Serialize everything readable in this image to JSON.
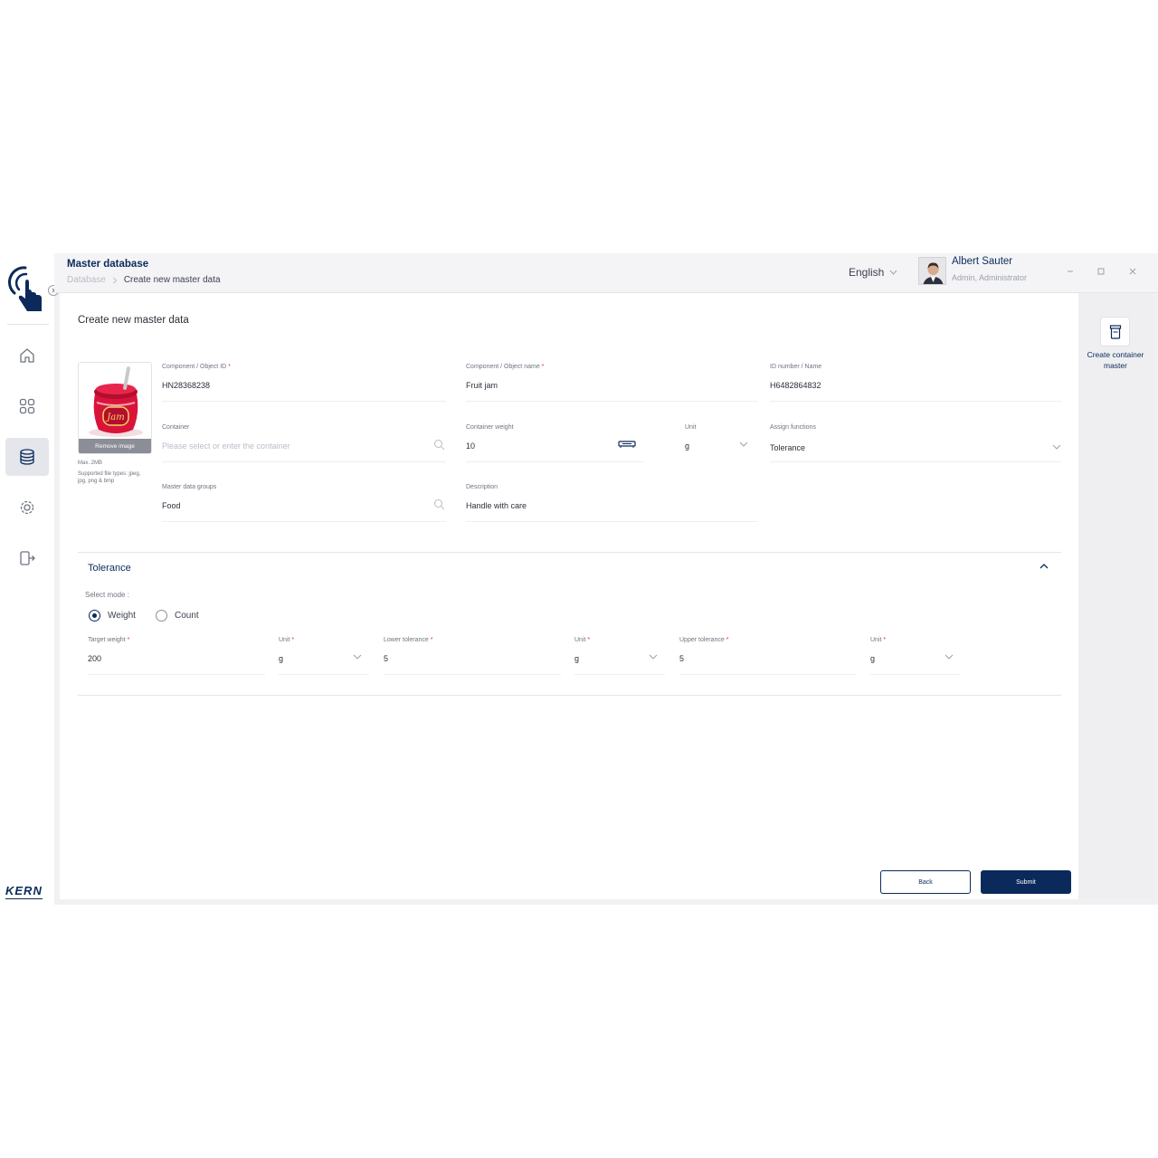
{
  "header": {
    "title": "Master database",
    "breadcrumb": [
      "Database",
      "Create new master data"
    ],
    "language": "English",
    "user": {
      "name": "Albert Sauter",
      "role": "Admin, Administrator"
    }
  },
  "sidebar": {
    "items": [
      {
        "icon": "home-icon",
        "active": false
      },
      {
        "icon": "dashboard-icon",
        "active": false
      },
      {
        "icon": "database-icon",
        "active": true
      },
      {
        "icon": "settings-icon",
        "active": false
      },
      {
        "icon": "logout-icon",
        "active": false
      }
    ],
    "brand": "KERN"
  },
  "form": {
    "title": "Create new master data",
    "image": {
      "remove_label": "Remove image",
      "max_size": "Max. 2MB",
      "supported_types": "Supported file types: jpeg, jpg, png & bmp"
    },
    "component_id": {
      "label": "Component / Object ID",
      "value": "HN28368238"
    },
    "component_name": {
      "label": "Component / Object name",
      "value": "Fruit jam"
    },
    "id_number": {
      "label": "ID number / Name",
      "value": "H6482864832"
    },
    "container": {
      "label": "Container",
      "placeholder": "Please select or enter the container"
    },
    "container_weight": {
      "label": "Container weight",
      "value": "10"
    },
    "unit": {
      "label": "Unit",
      "value": "g"
    },
    "assign_functions": {
      "label": "Assign functions",
      "value": "Tolerance"
    },
    "master_data_groups": {
      "label": "Master data groups",
      "value": "Food"
    },
    "description": {
      "label": "Description",
      "value": "Handle with care"
    }
  },
  "tolerance": {
    "title": "Tolerance",
    "select_mode_label": "Select mode :",
    "modes": [
      {
        "label": "Weight",
        "checked": true
      },
      {
        "label": "Count",
        "checked": false
      }
    ],
    "target_weight": {
      "label": "Target weight",
      "value": "200"
    },
    "target_unit": {
      "label": "Unit",
      "value": "g"
    },
    "lower_tolerance": {
      "label": "Lower tolerance",
      "value": "5"
    },
    "lower_unit": {
      "label": "Unit",
      "value": "g"
    },
    "upper_tolerance": {
      "label": "Upper tolerance",
      "value": "5"
    },
    "upper_unit": {
      "label": "Unit",
      "value": "g"
    }
  },
  "actions": {
    "back": "Back",
    "submit": "Submit"
  },
  "right_panel": {
    "create_container_label": "Create container master"
  },
  "colors": {
    "brand": "#0b2a5b",
    "required": "#d33b3b",
    "jar_red": "#d9143a"
  }
}
